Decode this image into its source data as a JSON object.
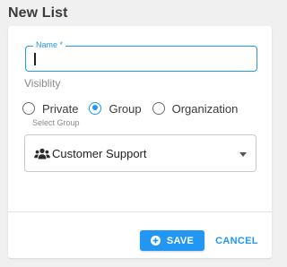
{
  "page": {
    "title": "New List"
  },
  "name_field": {
    "label": "Name *",
    "value": ""
  },
  "visibility": {
    "label": "Visiblity",
    "options": [
      {
        "label": "Private",
        "checked": false
      },
      {
        "label": "Group",
        "checked": true
      },
      {
        "label": "Organization",
        "checked": false
      }
    ]
  },
  "group_select": {
    "label": "Select Group",
    "selected": "Customer Support",
    "icon": "users-icon"
  },
  "actions": {
    "save_label": "SAVE",
    "save_icon": "plus-circle-icon",
    "cancel_label": "CANCEL"
  },
  "colors": {
    "accent": "#2196f3",
    "background": "#f0f0f0",
    "card": "#ffffff"
  }
}
